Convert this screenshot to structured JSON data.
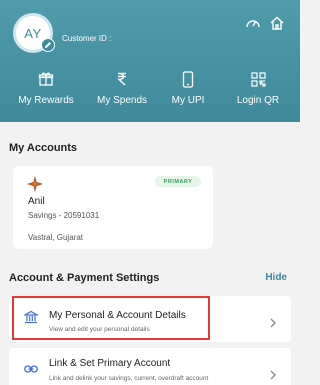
{
  "header": {
    "avatar_initials": "AY",
    "customer_id_label": "Customer ID :",
    "quick_actions": [
      {
        "label": "My Rewards",
        "icon": "gift-icon"
      },
      {
        "label": "My Spends",
        "icon": "rupee-icon"
      },
      {
        "label": "My UPI",
        "icon": "phone-icon"
      },
      {
        "label": "Login QR",
        "icon": "qr-icon"
      }
    ]
  },
  "accounts": {
    "section_title": "My Accounts",
    "card": {
      "badge": "PRIMARY",
      "name": "Anil",
      "account": "Savings - 20591031",
      "location": "Vastral, Gujarat"
    }
  },
  "settings": {
    "section_title": "Account & Payment Settings",
    "hide_label": "Hide",
    "rows": [
      {
        "title": "My Personal & Account Details",
        "subtitle": "View and edit your personal details"
      },
      {
        "title": "Link & Set Primary Account",
        "subtitle": "Link and delink your savings, current, overdraft account"
      }
    ]
  },
  "colors": {
    "header_teal": "#4f9cab",
    "accent": "#3f8a9b",
    "highlight_red": "#e53935",
    "primary_green": "#3aa35a"
  }
}
